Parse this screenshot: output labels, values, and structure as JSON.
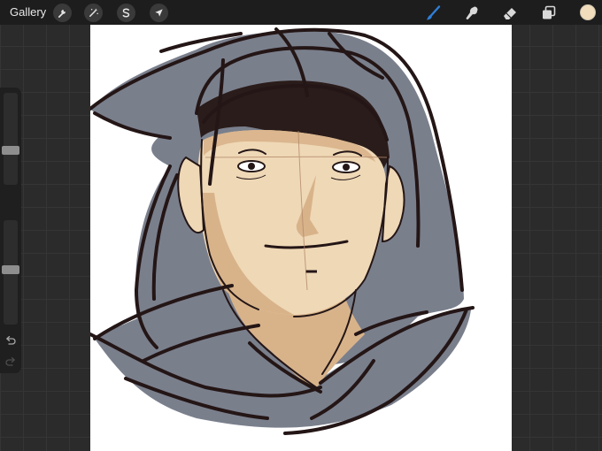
{
  "toolbar": {
    "gallery_label": "Gallery",
    "left_tools": [
      {
        "name": "actions",
        "icon": "wrench-icon"
      },
      {
        "name": "adjustments",
        "icon": "magic-wand-icon"
      },
      {
        "name": "selection",
        "icon": "selection-s-icon"
      },
      {
        "name": "transform",
        "icon": "cursor-arrow-icon"
      }
    ],
    "right_tools": [
      {
        "name": "brush",
        "icon": "brush-icon",
        "active": true
      },
      {
        "name": "smudge",
        "icon": "smudge-finger-icon"
      },
      {
        "name": "eraser",
        "icon": "eraser-icon"
      },
      {
        "name": "layers",
        "icon": "layers-icon"
      }
    ],
    "current_color": "#f1dcbc",
    "active_color": "#2f7fd8"
  },
  "sidebar": {
    "brush_size": 0.36,
    "opacity": 0.53,
    "modify_icon": "square-icon",
    "undo_icon": "undo-icon",
    "redo_icon": "redo-icon"
  },
  "canvas": {
    "background": "#ffffff",
    "palette": {
      "hood": "#7a7f8c",
      "skin_light": "#efd8b6",
      "skin_mid": "#d8b38a",
      "skin_shadow": "#c08e65",
      "hair": "#2a1c1a",
      "lineart": "#241616"
    }
  }
}
